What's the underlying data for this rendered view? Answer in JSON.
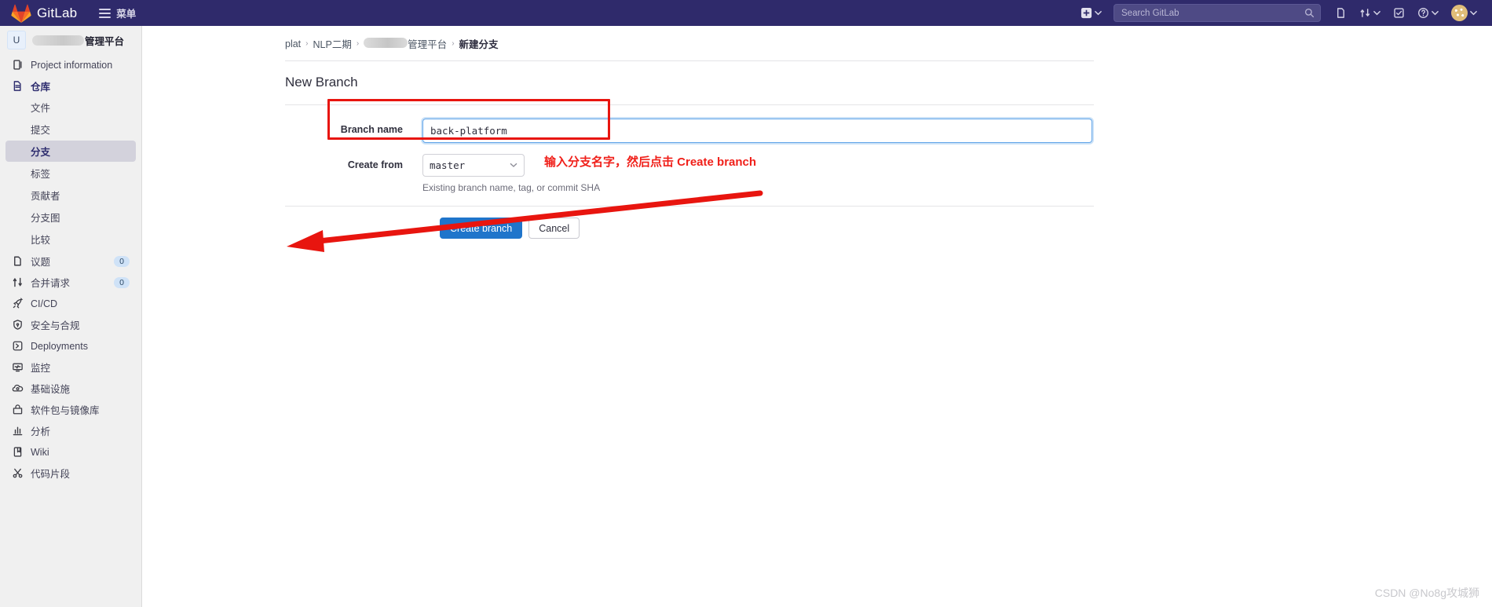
{
  "navbar": {
    "brand": "GitLab",
    "menu_label": "菜单",
    "logo_icon": "gitlab-tanuki-icon",
    "hamburger_icon": "hamburger-icon",
    "create_new_icon": "plus-square-icon",
    "create_new_chevron_icon": "chevron-down-icon",
    "search": {
      "placeholder": "Search GitLab",
      "icon": "search-icon"
    },
    "issues_icon": "issues-icon",
    "merge_requests_icon": "merge-request-icon",
    "merge_requests_chevron_icon": "chevron-down-icon",
    "todos_icon": "todo-check-icon",
    "help_icon": "question-circle-icon",
    "help_chevron_icon": "chevron-down-icon",
    "avatar_icon": "user-avatar",
    "avatar_chevron_icon": "chevron-down-icon"
  },
  "sidebar": {
    "project": {
      "initial": "U",
      "name_suffix": "管理平台",
      "redacted": true
    },
    "items": [
      {
        "label": "Project information",
        "icon": "project-info-icon",
        "type": "top"
      },
      {
        "label": "仓库",
        "icon": "repository-doc-icon",
        "type": "top",
        "active": true
      },
      {
        "label": "文件",
        "type": "sub"
      },
      {
        "label": "提交",
        "type": "sub"
      },
      {
        "label": "分支",
        "type": "sub",
        "current": true
      },
      {
        "label": "标签",
        "type": "sub"
      },
      {
        "label": "贡献者",
        "type": "sub"
      },
      {
        "label": "分支图",
        "type": "sub"
      },
      {
        "label": "比较",
        "type": "sub"
      },
      {
        "label": "议题",
        "icon": "issues-icon",
        "type": "top",
        "badge": "0"
      },
      {
        "label": "合并请求",
        "icon": "merge-request-icon",
        "type": "top",
        "badge": "0"
      },
      {
        "label": "CI/CD",
        "icon": "rocket-icon",
        "type": "top"
      },
      {
        "label": "安全与合规",
        "icon": "shield-icon",
        "type": "top"
      },
      {
        "label": "Deployments",
        "icon": "deployments-icon",
        "type": "top"
      },
      {
        "label": "监控",
        "icon": "monitor-icon",
        "type": "top"
      },
      {
        "label": "基础设施",
        "icon": "cloud-gear-icon",
        "type": "top"
      },
      {
        "label": "软件包与镜像库",
        "icon": "package-icon",
        "type": "top"
      },
      {
        "label": "分析",
        "icon": "chart-bar-icon",
        "type": "top"
      },
      {
        "label": "Wiki",
        "icon": "book-icon",
        "type": "top"
      },
      {
        "label": "代码片段",
        "icon": "scissors-icon",
        "type": "top"
      }
    ]
  },
  "breadcrumb": {
    "items": [
      {
        "label": "plat",
        "redacted": false
      },
      {
        "label": "NLP二期",
        "redacted": false
      },
      {
        "label": "管理平台",
        "redacted": true
      },
      {
        "label": "新建分支",
        "current": true
      }
    ],
    "separator": "›"
  },
  "page": {
    "title": "New Branch"
  },
  "form": {
    "branch_name": {
      "label": "Branch name",
      "value": "back-platform"
    },
    "create_from": {
      "label": "Create from",
      "value": "master",
      "chevron_icon": "chevron-down-icon",
      "help": "Existing branch name, tag, or commit SHA"
    },
    "submit_label": "Create branch",
    "cancel_label": "Cancel"
  },
  "annotations": {
    "instruction": "输入分支名字，然后点击 Create branch",
    "highlight_color": "#e8150f",
    "arrow_icon": "arrow-pointer-icon"
  },
  "watermark": {
    "text": "CSDN @No8g攻城狮"
  }
}
